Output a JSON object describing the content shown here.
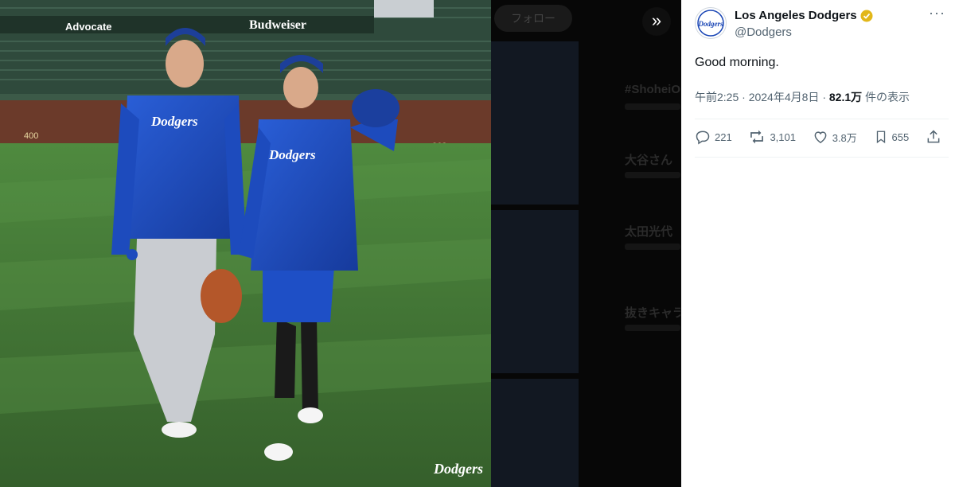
{
  "media": {
    "stadium_sign_1": "Advocate",
    "stadium_sign_2": "Budweiser",
    "hoodie_text": "Dodgers",
    "watermark": "Dodgers",
    "wall_number_left": "400",
    "wall_number_right": "368"
  },
  "backdrop": {
    "follow_label": "フォロー",
    "trends": [
      "#ShoheiOhtani",
      "大谷さん",
      "太田光代",
      "抜きキャラ"
    ]
  },
  "tweet": {
    "display_name": "Los Angeles Dodgers",
    "handle": "@Dodgers",
    "text": "Good morning.",
    "time": "午前2:25",
    "date": "2024年4月8日",
    "sep": "·",
    "views_count": "82.1万",
    "views_label": "件の表示",
    "replies": "221",
    "reposts": "3,101",
    "likes": "3.8万",
    "bookmarks": "655"
  },
  "icons": {
    "expand": "chevrons-right-icon",
    "more": "more-icon",
    "reply": "reply-icon",
    "repost": "repost-icon",
    "like": "heart-icon",
    "bookmark": "bookmark-icon",
    "share": "share-icon",
    "verified": "verified-badge-icon"
  },
  "colors": {
    "dodger_blue": "#1a46b5",
    "verified_gold": "#e2b719",
    "text_primary": "#0f1419",
    "text_secondary": "#536471"
  }
}
